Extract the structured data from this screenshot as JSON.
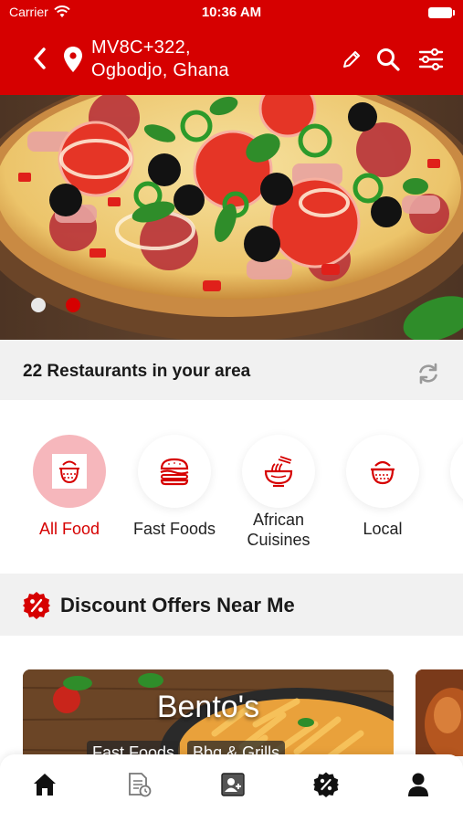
{
  "status_bar": {
    "carrier": "Carrier",
    "time": "10:36 AM"
  },
  "header": {
    "address_line1": "MV8C+322,",
    "address_line2": "Ogbodjo, Ghana"
  },
  "hero": {
    "slide_count": 2,
    "active_slide": 2
  },
  "restaurants": {
    "label": "22 Restaurants in your area"
  },
  "categories": [
    {
      "label": "All Food",
      "active": true,
      "icon": "pot-icon"
    },
    {
      "label": "Fast Foods",
      "active": false,
      "icon": "burger-icon"
    },
    {
      "label": "African Cuisines",
      "active": false,
      "icon": "noodle-bowl-icon"
    },
    {
      "label": "Local",
      "active": false,
      "icon": "pot-icon"
    }
  ],
  "discount": {
    "label": "Discount Offers Near Me"
  },
  "offer_card": {
    "title": "Bento's",
    "tags": [
      "Fast Foods",
      "Bbq & Grills"
    ]
  },
  "tab_bar": {
    "icons": [
      "home-icon",
      "orders-icon",
      "contacts-icon",
      "discount-icon",
      "profile-icon"
    ]
  },
  "colors": {
    "brand": "#d60000",
    "active_category_bg": "#f6b7bc",
    "bar_bg": "#f1f1f1"
  }
}
